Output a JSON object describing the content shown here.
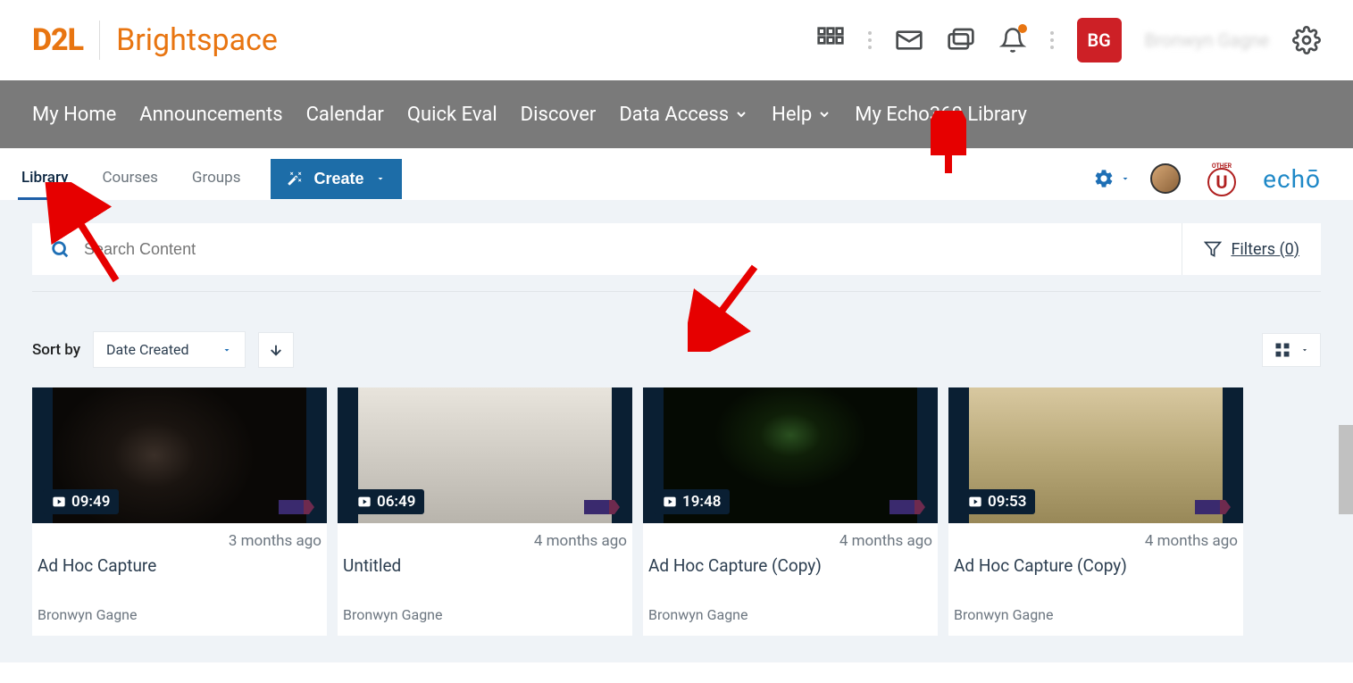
{
  "header": {
    "brand_logo": "D2L",
    "brand_text": "Brightspace",
    "avatar_initials": "BG",
    "user_name": "Bronwyn Gagne"
  },
  "nav": {
    "items": [
      "My Home",
      "Announcements",
      "Calendar",
      "Quick Eval",
      "Discover",
      "Data Access",
      "Help",
      "My Echo360 Library"
    ]
  },
  "echo_tabs": {
    "items": [
      "Library",
      "Courses",
      "Groups"
    ],
    "active": 0,
    "create_label": "Create"
  },
  "echo_brand": "echō",
  "search": {
    "placeholder": "Search Content",
    "filters_label": "Filters (0)"
  },
  "sort": {
    "label": "Sort by",
    "selected": "Date Created"
  },
  "cards": [
    {
      "duration": "09:49",
      "time": "3 months ago",
      "title": "Ad Hoc Capture",
      "author": "Bronwyn Gagne"
    },
    {
      "duration": "06:49",
      "time": "4 months ago",
      "title": "Untitled",
      "author": "Bronwyn Gagne"
    },
    {
      "duration": "19:48",
      "time": "4 months ago",
      "title": "Ad Hoc Capture (Copy)",
      "author": "Bronwyn Gagne"
    },
    {
      "duration": "09:53",
      "time": "4 months ago",
      "title": "Ad Hoc Capture (Copy)",
      "author": "Bronwyn Gagne"
    }
  ]
}
